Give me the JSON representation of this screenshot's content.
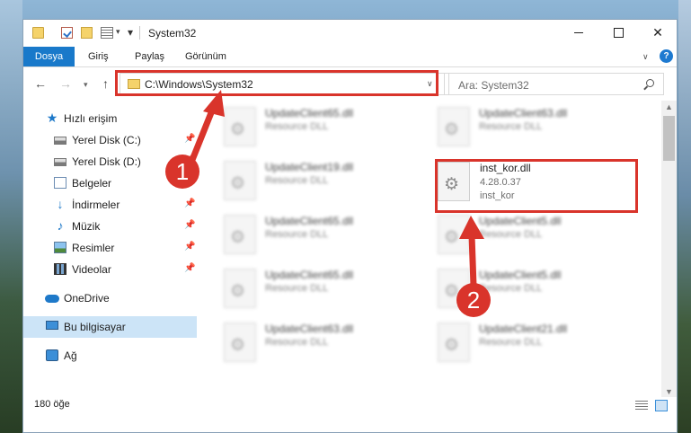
{
  "window": {
    "title": "System32",
    "minimize_icon": "minimize-icon",
    "maximize_icon": "maximize-icon",
    "close_glyph": "✕"
  },
  "ribbon": {
    "tabs": [
      "Dosya",
      "Giriş",
      "Paylaş",
      "Görünüm"
    ],
    "help_glyph": "?"
  },
  "address_bar": {
    "path": "C:\\Windows\\System32",
    "refresh_glyph": "↻"
  },
  "search": {
    "placeholder": "Ara: System32"
  },
  "sidebar": {
    "items": [
      {
        "label": "Hızlı erişim",
        "icon": "star-icon"
      },
      {
        "label": "Yerel Disk (C:)",
        "icon": "drive-icon",
        "pinned": true
      },
      {
        "label": "Yerel Disk (D:)",
        "icon": "drive-icon",
        "pinned": true
      },
      {
        "label": "Belgeler",
        "icon": "documents-icon",
        "pinned": true
      },
      {
        "label": "İndirmeler",
        "icon": "download-icon",
        "pinned": true
      },
      {
        "label": "Müzik",
        "icon": "music-icon",
        "pinned": true
      },
      {
        "label": "Resimler",
        "icon": "pictures-icon",
        "pinned": true
      },
      {
        "label": "Videolar",
        "icon": "video-icon",
        "pinned": true
      },
      {
        "label": "OneDrive",
        "icon": "cloud-icon"
      },
      {
        "label": "Bu bilgisayar",
        "icon": "computer-icon",
        "selected": true
      },
      {
        "label": "Ağ",
        "icon": "network-icon"
      }
    ]
  },
  "files": [
    {
      "name": "UpdateClient65.dll",
      "desc": "Resource DLL"
    },
    {
      "name": "UpdateClient63.dll",
      "desc": "Resource DLL"
    },
    {
      "name": "UpdateClient19.dll",
      "desc": "Resource DLL"
    },
    {
      "name": "UpdateClient65.dll",
      "desc": "Resource DLL"
    },
    {
      "name": "UpdateClient5.dll",
      "desc": "Resource DLL"
    },
    {
      "name": "UpdateClient65.dll",
      "desc": "Resource DLL"
    },
    {
      "name": "UpdateClient5.dll",
      "desc": "Resource DLL"
    },
    {
      "name": "UpdateClient63.dll",
      "desc": "Resource DLL"
    },
    {
      "name": "UpdateClient21.dll",
      "desc": "Resource DLL"
    }
  ],
  "highlighted_file": {
    "name": "inst_kor.dll",
    "version": "4.28.0.37",
    "desc": "inst_kor"
  },
  "status": {
    "item_count": "180 öğe"
  },
  "annotations": {
    "step1": "1",
    "step2": "2",
    "color": "#d9342b"
  }
}
